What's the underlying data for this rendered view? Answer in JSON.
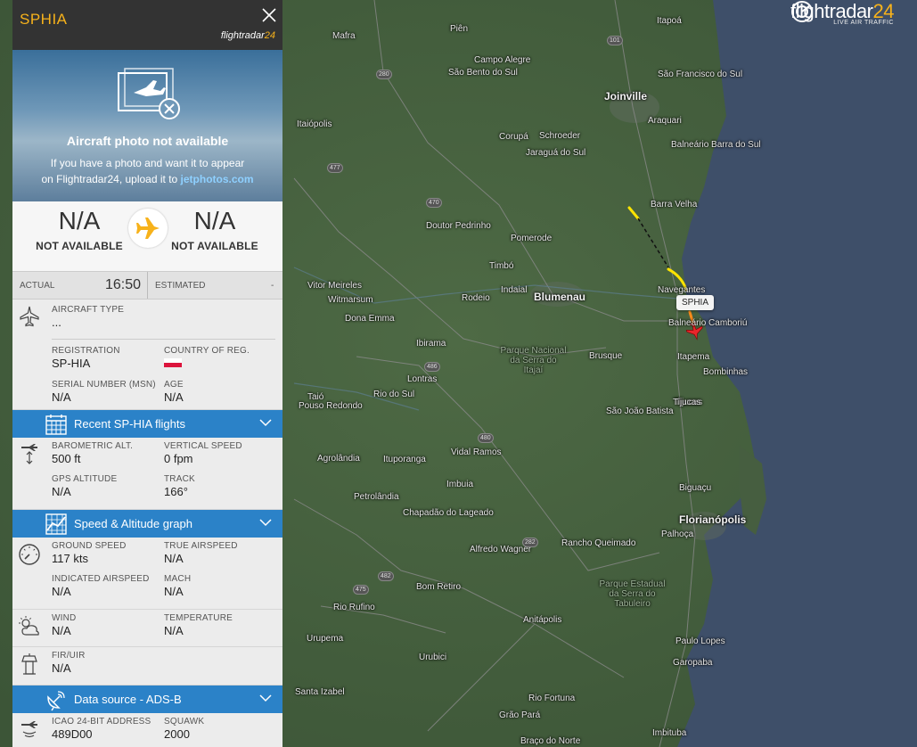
{
  "brand": {
    "logo_text": "flightradar",
    "logo_number": "24",
    "tagline": "LIVE AIR TRAFFIC"
  },
  "map": {
    "aircraft_label": "SPHIA",
    "cities": [
      {
        "name": "Joinville",
        "big": true
      },
      {
        "name": "Blumenau",
        "big": true
      },
      {
        "name": "Florianópolis",
        "big": true
      },
      {
        "name": "São Bento do Sul"
      },
      {
        "name": "Campo Alegre"
      },
      {
        "name": "Piên"
      },
      {
        "name": "Mafra"
      },
      {
        "name": "Itaiópolis"
      },
      {
        "name": "Corupá"
      },
      {
        "name": "Schroeder"
      },
      {
        "name": "Jaraguá do Sul"
      },
      {
        "name": "Araquari"
      },
      {
        "name": "São Francisco do Sul"
      },
      {
        "name": "Balneário Barra do Sul"
      },
      {
        "name": "Barra Velha"
      },
      {
        "name": "Doutor Pedrinho"
      },
      {
        "name": "Pomerode"
      },
      {
        "name": "Timbó"
      },
      {
        "name": "Indaial"
      },
      {
        "name": "Rodeio"
      },
      {
        "name": "Vitor Meireles"
      },
      {
        "name": "Witmarsum"
      },
      {
        "name": "Dona Emma"
      },
      {
        "name": "Navegantes"
      },
      {
        "name": "Balneário Camboriú"
      },
      {
        "name": "Itapema"
      },
      {
        "name": "Bombinhas"
      },
      {
        "name": "Brusque"
      },
      {
        "name": "Ibirama"
      },
      {
        "name": "Lontras"
      },
      {
        "name": "Rio do Sul"
      },
      {
        "name": "Taió"
      },
      {
        "name": "Pouso Redondo"
      },
      {
        "name": "Parque Nacional da Serra do Itajaí"
      },
      {
        "name": "São João Batista"
      },
      {
        "name": "Tijucas"
      },
      {
        "name": "Agrolândia"
      },
      {
        "name": "Ituporanga"
      },
      {
        "name": "Vidal Ramos"
      },
      {
        "name": "Petrolândia"
      },
      {
        "name": "Imbuia"
      },
      {
        "name": "Chapadão do Lageado"
      },
      {
        "name": "Biguaçu"
      },
      {
        "name": "Palhoça"
      },
      {
        "name": "Alfredo Wagner"
      },
      {
        "name": "Rancho Queimado"
      },
      {
        "name": "Bom Retiro"
      },
      {
        "name": "Parque Estadual da Serra do Tabuleiro"
      },
      {
        "name": "Rio Rufino"
      },
      {
        "name": "Anitápolis"
      },
      {
        "name": "Paulo Lopes"
      },
      {
        "name": "Urupema"
      },
      {
        "name": "Urubici"
      },
      {
        "name": "Garopaba"
      },
      {
        "name": "Rio Fortuna"
      },
      {
        "name": "Santa Izabel"
      },
      {
        "name": "Grão Pará"
      },
      {
        "name": "Braço do Norte"
      },
      {
        "name": "Imbituba"
      },
      {
        "name": "Itapoá"
      },
      {
        "name": "Tijucas"
      }
    ],
    "road_numbers": [
      "101",
      "280",
      "477",
      "470",
      "486",
      "282",
      "475",
      "482",
      "480"
    ]
  },
  "panel": {
    "callsign": "SPHIA",
    "mini_logo_text": "flightradar",
    "mini_logo_number": "24",
    "photo": {
      "title": "Aircraft photo not available",
      "line1": "If you have a photo and want it to appear",
      "line2_prefix": "on Flightradar24, upload it to ",
      "line2_link": "jetphotos.com"
    },
    "route": {
      "origin_code": "N/A",
      "origin_name": "NOT AVAILABLE",
      "dest_code": "N/A",
      "dest_name": "NOT AVAILABLE"
    },
    "times": {
      "actual_label": "ACTUAL",
      "actual_value": "16:50",
      "estimated_label": "ESTIMATED",
      "estimated_value": "-"
    },
    "aircraft": {
      "type_label": "AIRCRAFT TYPE",
      "type_value": "...",
      "registration_label": "REGISTRATION",
      "registration_value": "SP-HIA",
      "country_label": "COUNTRY OF REG.",
      "serial_label": "SERIAL NUMBER (MSN)",
      "serial_value": "N/A",
      "age_label": "AGE",
      "age_value": "N/A"
    },
    "band_recent": "Recent SP-HIA flights",
    "altitude": {
      "baro_label": "BAROMETRIC ALT.",
      "baro_value": "500 ft",
      "vs_label": "VERTICAL SPEED",
      "vs_value": "0 fpm",
      "gps_label": "GPS ALTITUDE",
      "gps_value": "N/A",
      "track_label": "TRACK",
      "track_value": "166°"
    },
    "band_graph": "Speed & Altitude graph",
    "speed": {
      "gs_label": "GROUND SPEED",
      "gs_value": "117 kts",
      "tas_label": "TRUE AIRSPEED",
      "tas_value": "N/A",
      "ias_label": "INDICATED AIRSPEED",
      "ias_value": "N/A",
      "mach_label": "MACH",
      "mach_value": "N/A"
    },
    "weather": {
      "wind_label": "WIND",
      "wind_value": "N/A",
      "temp_label": "TEMPERATURE",
      "temp_value": "N/A"
    },
    "fir": {
      "label": "FIR/UIR",
      "value": "N/A"
    },
    "band_source": "Data source - ADS-B",
    "transponder": {
      "icao_label": "ICAO 24-BIT ADDRESS",
      "icao_value": "489D00",
      "squawk_label": "SQUAWK",
      "squawk_value": "2000"
    }
  }
}
